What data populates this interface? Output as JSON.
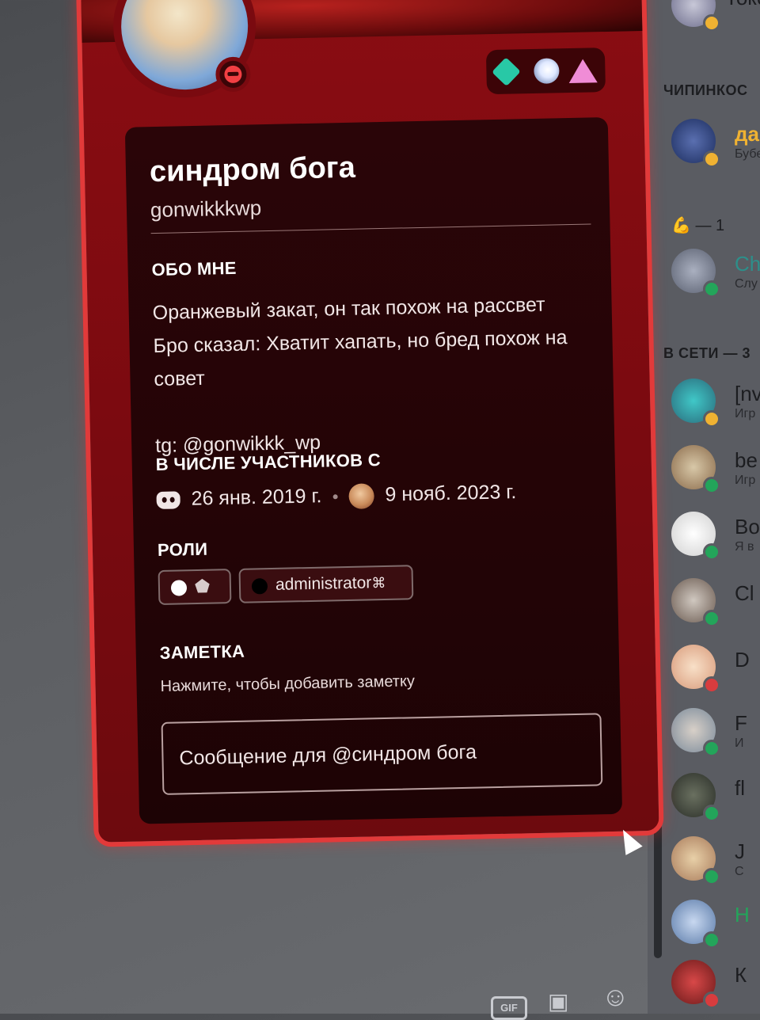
{
  "profile": {
    "display_name": "синдром бога",
    "username": "gonwikkkwp",
    "about_title": "ОБО МНЕ",
    "about_lines": [
      "Оранжевый закат, он так похож на рассвет",
      "Бро сказал: Хватит хапать, но бред похож на",
      "совет",
      "",
      "tg: @gonwikkk_wp"
    ],
    "member_since_title": "В ЧИСЛЕ УЧАСТНИКОВ С",
    "discord_since": "26 янв. 2019 г.",
    "server_since": "9 нояб. 2023 г.",
    "roles_title": "РОЛИ",
    "roles": [
      {
        "label": "",
        "dot_color": "#ffffff"
      },
      {
        "label": "administrator",
        "dot_color": "#000000"
      }
    ],
    "note_title": "ЗАМЕТКА",
    "note_placeholder": "Нажмите, чтобы добавить заметку",
    "message_placeholder": "Сообщение для @синдром бога",
    "status": "dnd",
    "badges": [
      "nitro-diamond-badge",
      "boost-orb-badge",
      "hypesquad-triangle-badge"
    ]
  },
  "member_list": {
    "sections": [
      {
        "title": "ЧИПИНКОС"
      },
      {
        "title": "В СЕТИ — 3"
      }
    ],
    "reaction": "💪 — 1",
    "members": [
      {
        "name": "Токс",
        "sub": "",
        "status": "idle"
      },
      {
        "name": "даш",
        "sub": "Бубе",
        "status": "idle"
      },
      {
        "name": "Ch",
        "sub": "Слу",
        "status": "online"
      },
      {
        "name": "[nv",
        "sub": "Игр",
        "status": "idle"
      },
      {
        "name": "be",
        "sub": "Игр",
        "status": "online"
      },
      {
        "name": "Bo",
        "sub": "Я в",
        "status": "online"
      },
      {
        "name": "Cl",
        "sub": "",
        "status": "online"
      },
      {
        "name": "D",
        "sub": "",
        "status": "dnd"
      },
      {
        "name": "F",
        "sub": "И",
        "status": "online"
      },
      {
        "name": "fl",
        "sub": "",
        "status": "online"
      },
      {
        "name": "J",
        "sub": "С",
        "status": "online"
      },
      {
        "name": "Н",
        "sub": "",
        "status": "online"
      },
      {
        "name": "К",
        "sub": "",
        "status": "dnd"
      }
    ]
  },
  "toolbar": {
    "gif_label": "GIF"
  },
  "colors": {
    "popout_bg": "#7a0a10",
    "popout_border": "#e23a3a",
    "card_bg": "#230406",
    "online": "#23a55a",
    "dnd": "#d83c3e",
    "idle": "#f0b232"
  }
}
